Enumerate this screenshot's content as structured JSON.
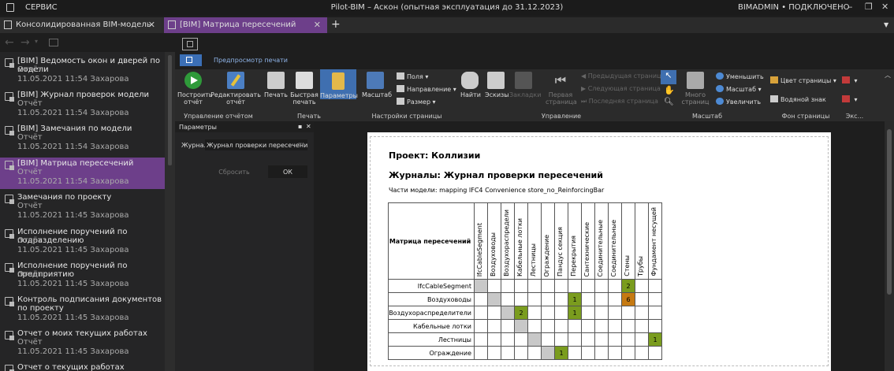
{
  "window": {
    "menu": "СЕРВИС",
    "title": "Pilot-BIM – Аскон (опытная эксплуатация до 31.12.2023)",
    "user": "BIMADMIN • ПОДКЛЮЧЕНО"
  },
  "tabs": [
    {
      "label": "Консолидированная BIM-модель"
    },
    {
      "label": "[BIM] Матрица пересечений"
    }
  ],
  "sidebar": {
    "items": [
      {
        "title": "[BIM] Ведомость окон и дверей по модели",
        "type": "Отчёт",
        "meta": "11.05.2021 11:54 Захарова"
      },
      {
        "title": "[BIM] Журнал проверок модели",
        "type": "Отчёт",
        "meta": "11.05.2021 11:54 Захарова"
      },
      {
        "title": "[BIM] Замечания по модели",
        "type": "Отчёт",
        "meta": "11.05.2021 11:54 Захарова"
      },
      {
        "title": "[BIM] Матрица пересечений",
        "type": "Отчёт",
        "meta": "11.05.2021 11:54 Захарова"
      },
      {
        "title": "Замечания по проекту",
        "type": "Отчёт",
        "meta": "11.05.2021 11:45 Захарова"
      },
      {
        "title": "Исполнение поручений по подразделению",
        "type": "Отчёт",
        "meta": "11.05.2021 11:45 Захарова"
      },
      {
        "title": "Исполнение поручений по предприятию",
        "type": "Отчёт",
        "meta": "11.05.2021 11:45 Захарова"
      },
      {
        "title": "Контроль подписания документов по проекту",
        "type": "",
        "meta": "11.05.2021 11:45 Захарова"
      },
      {
        "title": "Отчет о моих текущих работах",
        "type": "Отчёт",
        "meta": "11.05.2021 11:45 Захарова"
      },
      {
        "title": "Отчет о текущих работах выбранного",
        "type": "",
        "meta": ""
      }
    ]
  },
  "ribbon": {
    "tab": "Предпросмотр печати",
    "buttons": {
      "build": "Построить отчёт",
      "edit": "Редактировать отчёт",
      "print": "Печать",
      "quick_print": "Быстрая печать",
      "params": "Параметры",
      "scale": "Масштаб",
      "find": "Найти",
      "thumbs": "Эскизы",
      "bookmarks": "Закладки",
      "first_page": "Первая страница",
      "multi_page": "Много страниц"
    },
    "small": {
      "margins": "Поля",
      "orientation": "Направление",
      "size": "Размер",
      "prev_page": "Предыдущая страница",
      "next_page": "Следующая страница",
      "last_page": "Последняя страница",
      "zoom_out": "Уменьшить",
      "zoom": "Масштаб",
      "zoom_in": "Увеличить",
      "page_color": "Цвет страницы",
      "watermark": "Водяной знак"
    },
    "groups": {
      "report": "Управление отчётом",
      "print": "Печать",
      "page_setup": "Настройки страницы",
      "navigation": "Управление",
      "scale": "Масштаб",
      "background": "Фон страницы",
      "export": "Экс..."
    }
  },
  "params_panel": {
    "title": "Параметры",
    "field_label": "Журнал",
    "field_value": "Журнал проверки пересечений",
    "reset": "Сбросить",
    "ok": "ОК"
  },
  "report": {
    "project": "Проект: Коллизии",
    "journals": "Журналы: Журнал проверки пересечений",
    "model_parts": "Части модели: mapping IFC4 Convenience store_no_ReinforcingBar",
    "matrix_title": "Матрица пересечений",
    "columns": [
      "IfcCableSegment",
      "Воздуховоды",
      "Воздухораспредели",
      "Кабельные лотки",
      "Лестницы",
      "Ограждение",
      "Пандус секция",
      "Перекрытия",
      "Сантехнические",
      "Соединительные",
      "Соединительные",
      "Стены",
      "Трубы",
      "Фундамент несущей"
    ],
    "rows": [
      {
        "label": "IfcCableSegment",
        "cells": [
          "g",
          "",
          "",
          "",
          "",
          "",
          "",
          "",
          "",
          "",
          "",
          "2",
          "",
          ""
        ]
      },
      {
        "label": "Воздуховоды",
        "cells": [
          "",
          "g",
          "",
          "",
          "",
          "",
          "",
          "1",
          "",
          "",
          "",
          "6",
          "",
          ""
        ]
      },
      {
        "label": "Воздухораспределители",
        "cells": [
          "",
          "",
          "g",
          "2",
          "",
          "",
          "",
          "1",
          "",
          "",
          "",
          "",
          "",
          ""
        ]
      },
      {
        "label": "Кабельные лотки",
        "cells": [
          "",
          "",
          "",
          "g",
          "",
          "",
          "",
          "",
          "",
          "",
          "",
          "",
          "",
          ""
        ]
      },
      {
        "label": "Лестницы",
        "cells": [
          "",
          "",
          "",
          "",
          "g",
          "",
          "",
          "",
          "",
          "",
          "",
          "",
          "",
          "1"
        ]
      },
      {
        "label": "Ограждение",
        "cells": [
          "",
          "",
          "",
          "",
          "",
          "g",
          "1",
          "",
          "",
          "",
          "",
          "",
          "",
          ""
        ]
      }
    ],
    "cell_colors": {
      "2": "#7a9c1e",
      "1": "#7a9c1e",
      "6": "#c67a12"
    }
  }
}
